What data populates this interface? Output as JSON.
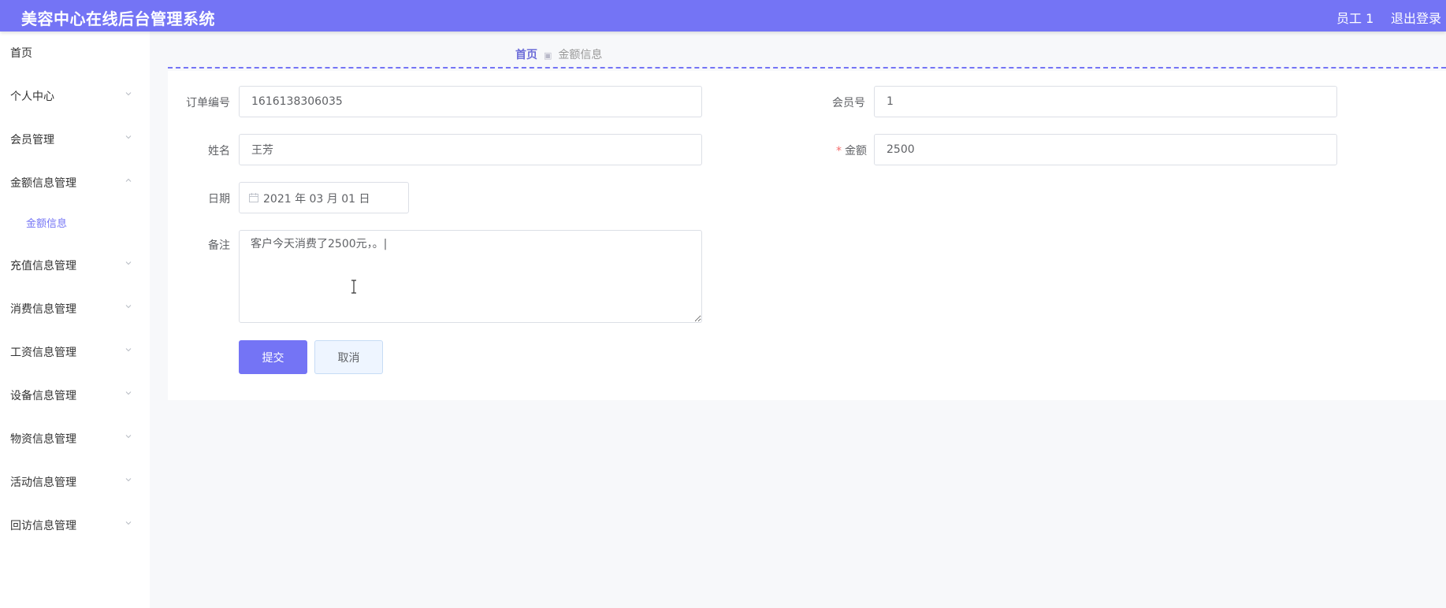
{
  "header": {
    "title": "美容中心在线后台管理系统",
    "user": "员工 1",
    "logout": "退出登录"
  },
  "sidebar": {
    "items": [
      {
        "label": "首页"
      },
      {
        "label": "个人中心"
      },
      {
        "label": "会员管理"
      },
      {
        "label": "金额信息管理",
        "expanded": true
      },
      {
        "label": "充值信息管理"
      },
      {
        "label": "消费信息管理"
      },
      {
        "label": "工资信息管理"
      },
      {
        "label": "设备信息管理"
      },
      {
        "label": "物资信息管理"
      },
      {
        "label": "活动信息管理"
      },
      {
        "label": "回访信息管理"
      }
    ],
    "subitems": [
      {
        "label": "金额信息",
        "active": true
      }
    ]
  },
  "breadcrumb": {
    "home": "首页",
    "current": "金额信息"
  },
  "form": {
    "order_no": {
      "label": "订单编号",
      "value": "1616138306035"
    },
    "member_no": {
      "label": "会员号",
      "value": "1"
    },
    "name": {
      "label": "姓名",
      "value": "王芳"
    },
    "amount": {
      "label": "金额",
      "required_mark": "*",
      "value": "2500"
    },
    "date": {
      "label": "日期",
      "value": "2021 年 03 月 01 日"
    },
    "remark": {
      "label": "备注",
      "value": "客户今天消费了2500元，。|"
    },
    "submit_label": "提交",
    "cancel_label": "取消"
  },
  "colors": {
    "primary": "#7474f5",
    "required": "#f56c6c"
  },
  "icons": {
    "chevron": "chevron-icon",
    "calendar": "calendar-icon",
    "cursor": "text-cursor-icon"
  }
}
